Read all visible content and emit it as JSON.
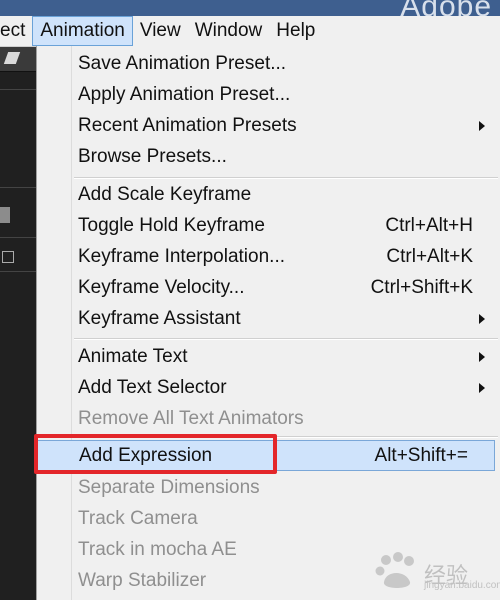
{
  "window": {
    "title_fragment": "Adobe"
  },
  "menubar": {
    "items": [
      {
        "label": "ect"
      },
      {
        "label": "Animation"
      },
      {
        "label": "View"
      },
      {
        "label": "Window"
      },
      {
        "label": "Help"
      }
    ],
    "active_index": 1
  },
  "animation_menu": {
    "items": [
      {
        "label": "Save Animation Preset...",
        "shortcut": "",
        "submenu": false,
        "disabled": false
      },
      {
        "label": "Apply Animation Preset...",
        "shortcut": "",
        "submenu": false,
        "disabled": false
      },
      {
        "label": "Recent Animation Presets",
        "shortcut": "",
        "submenu": true,
        "disabled": false
      },
      {
        "label": "Browse Presets...",
        "shortcut": "",
        "submenu": false,
        "disabled": false
      },
      {
        "label": "Add Scale Keyframe",
        "shortcut": "",
        "submenu": false,
        "disabled": false
      },
      {
        "label": "Toggle Hold Keyframe",
        "shortcut": "Ctrl+Alt+H",
        "submenu": false,
        "disabled": false
      },
      {
        "label": "Keyframe Interpolation...",
        "shortcut": "Ctrl+Alt+K",
        "submenu": false,
        "disabled": false
      },
      {
        "label": "Keyframe Velocity...",
        "shortcut": "Ctrl+Shift+K",
        "submenu": false,
        "disabled": false
      },
      {
        "label": "Keyframe Assistant",
        "shortcut": "",
        "submenu": true,
        "disabled": false
      },
      {
        "label": "Animate Text",
        "shortcut": "",
        "submenu": true,
        "disabled": false
      },
      {
        "label": "Add Text Selector",
        "shortcut": "",
        "submenu": true,
        "disabled": false
      },
      {
        "label": "Remove All Text Animators",
        "shortcut": "",
        "submenu": false,
        "disabled": true
      },
      {
        "label": "Add Expression",
        "shortcut": "Alt+Shift+=",
        "submenu": false,
        "disabled": false,
        "highlighted": true
      },
      {
        "label": "Separate Dimensions",
        "shortcut": "",
        "submenu": false,
        "disabled": true
      },
      {
        "label": "Track Camera",
        "shortcut": "",
        "submenu": false,
        "disabled": true
      },
      {
        "label": "Track in mocha AE",
        "shortcut": "",
        "submenu": false,
        "disabled": true
      },
      {
        "label": "Warp Stabilizer",
        "shortcut": "",
        "submenu": false,
        "disabled": true
      }
    ]
  },
  "annotation": {
    "color": "#e3262a",
    "target_item": "Add Expression"
  },
  "watermark": {
    "text": "经验",
    "subtext": "jingyan.baidu.com"
  },
  "colors": {
    "menu_bg": "#f0f0f0",
    "highlight_bg": "#cfe3fb",
    "highlight_border": "#7aa7d8",
    "disabled_text": "#8f8f8f",
    "app_dark": "#202020",
    "title_bar": "#3e5f8f"
  }
}
